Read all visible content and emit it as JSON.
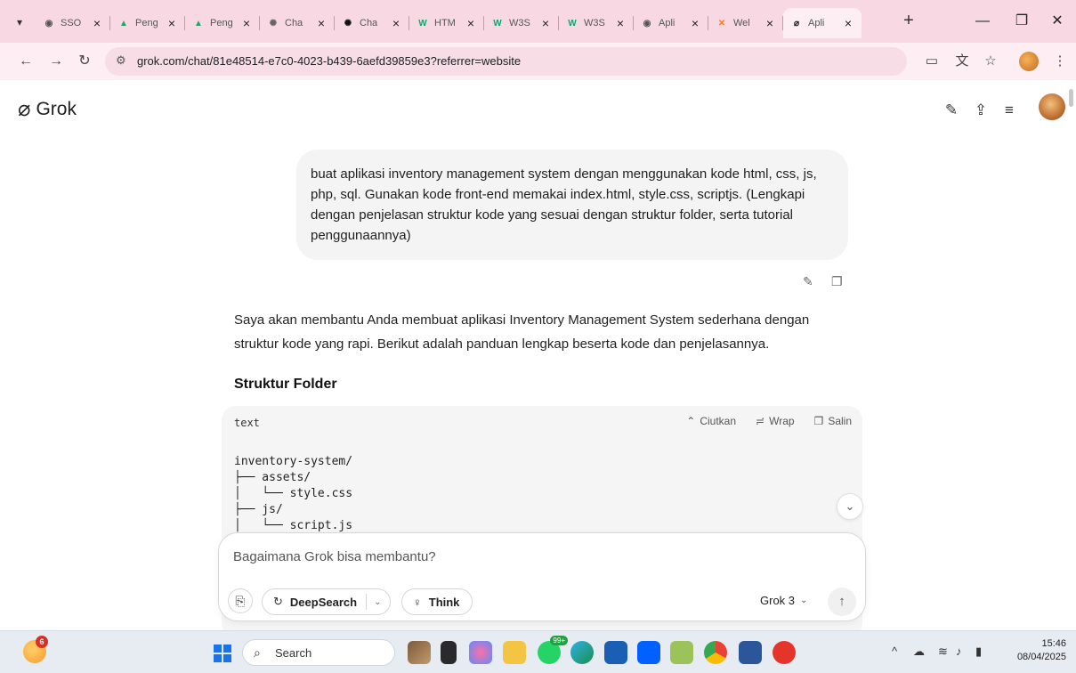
{
  "browser": {
    "tabs": [
      {
        "title": "SSO",
        "icon": "globe-icon",
        "color": "#555555",
        "active": false
      },
      {
        "title": "Peng",
        "icon": "google-drive-icon",
        "color": "#1fa463",
        "active": false
      },
      {
        "title": "Peng",
        "icon": "google-drive-icon",
        "color": "#1fa463",
        "active": false
      },
      {
        "title": "Cha",
        "icon": "chatgpt-icon",
        "color": "#666666",
        "active": false
      },
      {
        "title": "Cha",
        "icon": "chatgpt-icon",
        "color": "#111111",
        "active": false
      },
      {
        "title": "HTM",
        "icon": "w3schools-icon",
        "color": "#04aa6d",
        "active": false
      },
      {
        "title": "W3S",
        "icon": "w3schools-icon",
        "color": "#04aa6d",
        "active": false
      },
      {
        "title": "W3S",
        "icon": "w3schools-icon",
        "color": "#04aa6d",
        "active": false
      },
      {
        "title": "Apli",
        "icon": "globe-icon",
        "color": "#555555",
        "active": false
      },
      {
        "title": "Wel",
        "icon": "xampp-icon",
        "color": "#fb7a24",
        "active": false
      },
      {
        "title": "Apli",
        "icon": "grok-icon",
        "color": "#111111",
        "active": true
      }
    ],
    "url": "grok.com/chat/81e48514-e7c0-4023-b439-6aefd39859e3?referrer=website"
  },
  "app": {
    "name": "Grok"
  },
  "chat": {
    "user_message": "buat aplikasi inventory management system dengan menggunakan kode html, css, js, php, sql. Gunakan kode front-end memakai index.html, style.css, scriptjs. (Lengkapi dengan penjelasan struktur kode yang sesuai dengan struktur folder, serta tutorial penggunaannya)",
    "assistant_reply": "Saya akan membantu Anda membuat aplikasi Inventory Management System sederhana dengan struktur kode yang rapi. Berikut adalah panduan lengkap beserta kode dan penjelasannya.",
    "section_title": "Struktur Folder",
    "code_block": {
      "language": "text",
      "collapse_label": "Ciutkan",
      "wrap_label": "Wrap",
      "copy_label": "Salin",
      "lines": [
        "inventory-system/",
        "├── assets/",
        "│   └── style.css",
        "├── js/",
        "│   └── script.js"
      ]
    }
  },
  "composer": {
    "placeholder": "Bagaimana Grok bisa membantu?",
    "deepsearch_label": "DeepSearch",
    "think_label": "Think",
    "model_label": "Grok 3"
  },
  "taskbar": {
    "search_label": "Search",
    "weather_badge": "6",
    "whatsapp_badge": "99+",
    "time": "15:46",
    "date": "08/04/2025"
  }
}
